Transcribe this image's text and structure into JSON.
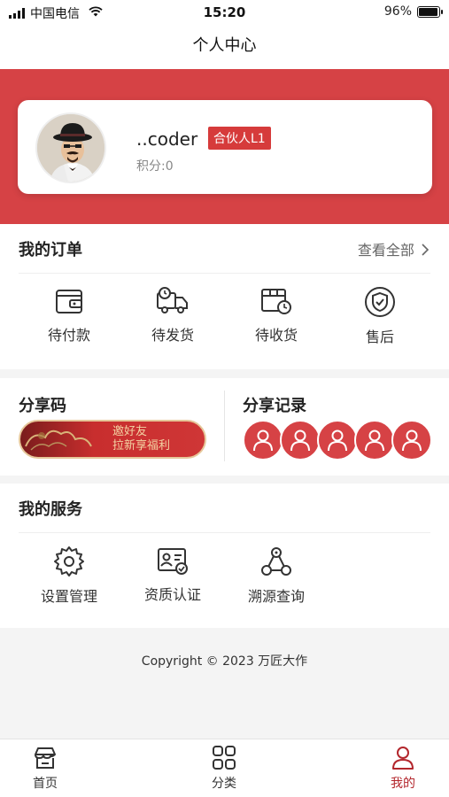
{
  "status_bar": {
    "carrier": "中国电信",
    "time": "15:20",
    "battery": "96%",
    "battery_level": 0.96
  },
  "nav": {
    "title": "个人中心"
  },
  "profile": {
    "username": "..coder",
    "badge": "合伙人L1",
    "points": "积分:0"
  },
  "orders": {
    "title": "我的订单",
    "view_all": "查看全部",
    "items": [
      {
        "label": "待付款",
        "icon": "wallet-icon"
      },
      {
        "label": "待发货",
        "icon": "truck-icon"
      },
      {
        "label": "待收货",
        "icon": "package-clock-icon"
      },
      {
        "label": "售后",
        "icon": "shield-check-icon"
      }
    ]
  },
  "share": {
    "code_title": "分享码",
    "invite_line1": "邀好友",
    "invite_line2": "拉新享福利",
    "record_title": "分享记录",
    "record_count": 5
  },
  "services": {
    "title": "我的服务",
    "items": [
      {
        "label": "设置管理",
        "icon": "gear-icon"
      },
      {
        "label": "资质认证",
        "icon": "id-card-icon"
      },
      {
        "label": "溯源查询",
        "icon": "trace-icon"
      }
    ]
  },
  "footer": {
    "copyright": "Copyright © 2023 万匠大作"
  },
  "tabbar": {
    "items": [
      {
        "label": "首页",
        "icon": "home-icon"
      },
      {
        "label": "分类",
        "icon": "grid-icon"
      },
      {
        "label": "我的",
        "icon": "user-icon",
        "active": true
      }
    ]
  },
  "colors": {
    "brand_red": "#d64245",
    "active_tab": "#b3262c"
  }
}
